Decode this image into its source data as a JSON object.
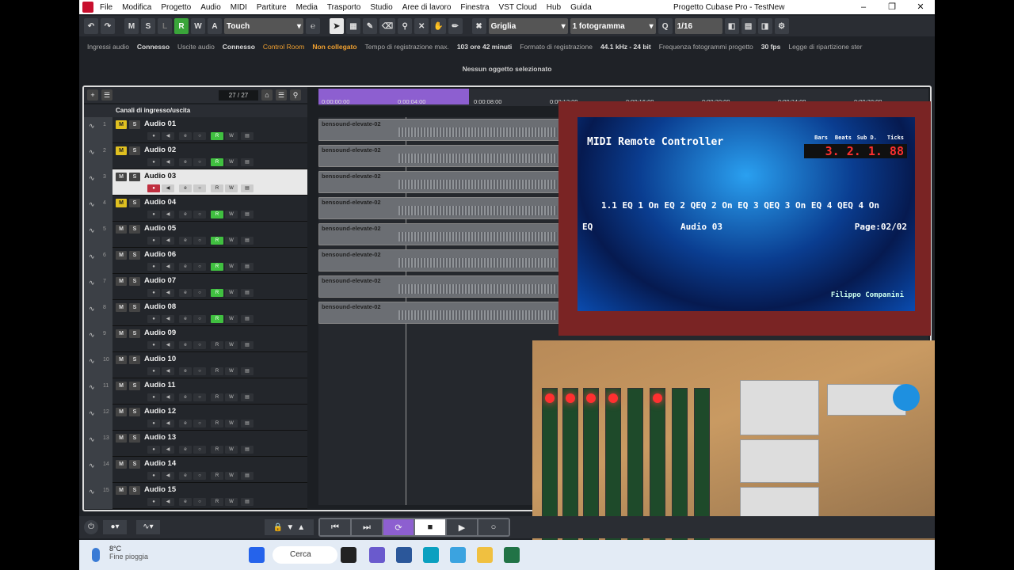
{
  "app": {
    "title": "Progetto Cubase Pro - TestNew",
    "menu": [
      "File",
      "Modifica",
      "Progetto",
      "Audio",
      "MIDI",
      "Partiture",
      "Media",
      "Trasporto",
      "Studio",
      "Aree di lavoro",
      "Finestra",
      "VST Cloud",
      "Hub",
      "Guida"
    ]
  },
  "toolbar": {
    "mode_buttons": [
      "M",
      "S",
      "L",
      "R",
      "W",
      "A"
    ],
    "automation_mode": "Touch",
    "snap_type": "Griglia",
    "frame_setting": "1 fotogramma",
    "quantize": "1/16"
  },
  "infoline": {
    "audio_inputs_label": "Ingressi audio",
    "audio_inputs_value": "Connesso",
    "audio_outputs_label": "Uscite audio",
    "audio_outputs_value": "Connesso",
    "control_room_label": "Control Room",
    "control_room_value": "Non collegato",
    "rec_time_label": "Tempo di registrazione max.",
    "rec_time_value": "103 ore 42 minuti",
    "format_label": "Formato di registrazione",
    "format_value": "44.1 kHz - 24 bit",
    "fps_label": "Frequenza fotogrammi progetto",
    "fps_value": "30 fps",
    "pan_label": "Legge di ripartizione ster"
  },
  "status": "Nessun oggetto selezionato",
  "tracklist": {
    "count": "27 / 27",
    "folder": "Canali di ingresso/uscita",
    "tracks": [
      {
        "num": "1",
        "name": "Audio 01",
        "mute": true,
        "r_on": true
      },
      {
        "num": "2",
        "name": "Audio 02",
        "mute": true,
        "r_on": true
      },
      {
        "num": "3",
        "name": "Audio 03",
        "mute": false,
        "r_on": true,
        "selected": true
      },
      {
        "num": "4",
        "name": "Audio 04",
        "mute": true,
        "r_on": true
      },
      {
        "num": "5",
        "name": "Audio 05",
        "mute": false,
        "r_on": true
      },
      {
        "num": "6",
        "name": "Audio 06",
        "mute": false,
        "r_on": true
      },
      {
        "num": "7",
        "name": "Audio 07",
        "mute": false,
        "r_on": true
      },
      {
        "num": "8",
        "name": "Audio 08",
        "mute": false,
        "r_on": true
      },
      {
        "num": "9",
        "name": "Audio 09",
        "mute": false,
        "r_on": false
      },
      {
        "num": "10",
        "name": "Audio 10",
        "mute": false,
        "r_on": false
      },
      {
        "num": "11",
        "name": "Audio 11",
        "mute": false,
        "r_on": false
      },
      {
        "num": "12",
        "name": "Audio 12",
        "mute": false,
        "r_on": false
      },
      {
        "num": "13",
        "name": "Audio 13",
        "mute": false,
        "r_on": false
      },
      {
        "num": "14",
        "name": "Audio 14",
        "mute": false,
        "r_on": false
      },
      {
        "num": "15",
        "name": "Audio 15",
        "mute": false,
        "r_on": false
      }
    ]
  },
  "ruler": [
    "0:00:00:00",
    "0:00:04:00",
    "0:00:08:00",
    "0:00:12:00",
    "0:00:16:00",
    "0:00:20:00",
    "0:00:24:00",
    "0:00:28:00"
  ],
  "clip_name": "bensound-elevate-02",
  "midi_screen": {
    "title": "MIDI Remote Controller",
    "headers": [
      "Bars",
      "Beats",
      "Sub D.",
      "Ticks"
    ],
    "position": "3. 2. 1. 88",
    "params": "1.1 EQ 1 On EQ 2 QEQ 2 On EQ 3 QEQ 3 On EQ 4 QEQ 4 On",
    "section": "EQ",
    "track": "Audio 03",
    "page": "Page:02/02",
    "author": "Filippo Companini"
  },
  "taskbar": {
    "temperature": "8°C",
    "weather": "Fine pioggia",
    "search": "Cerca"
  },
  "colors": {
    "accent_purple": "#8d5fd0",
    "record_green": "#40c040",
    "mute_yellow": "#e0c020"
  }
}
